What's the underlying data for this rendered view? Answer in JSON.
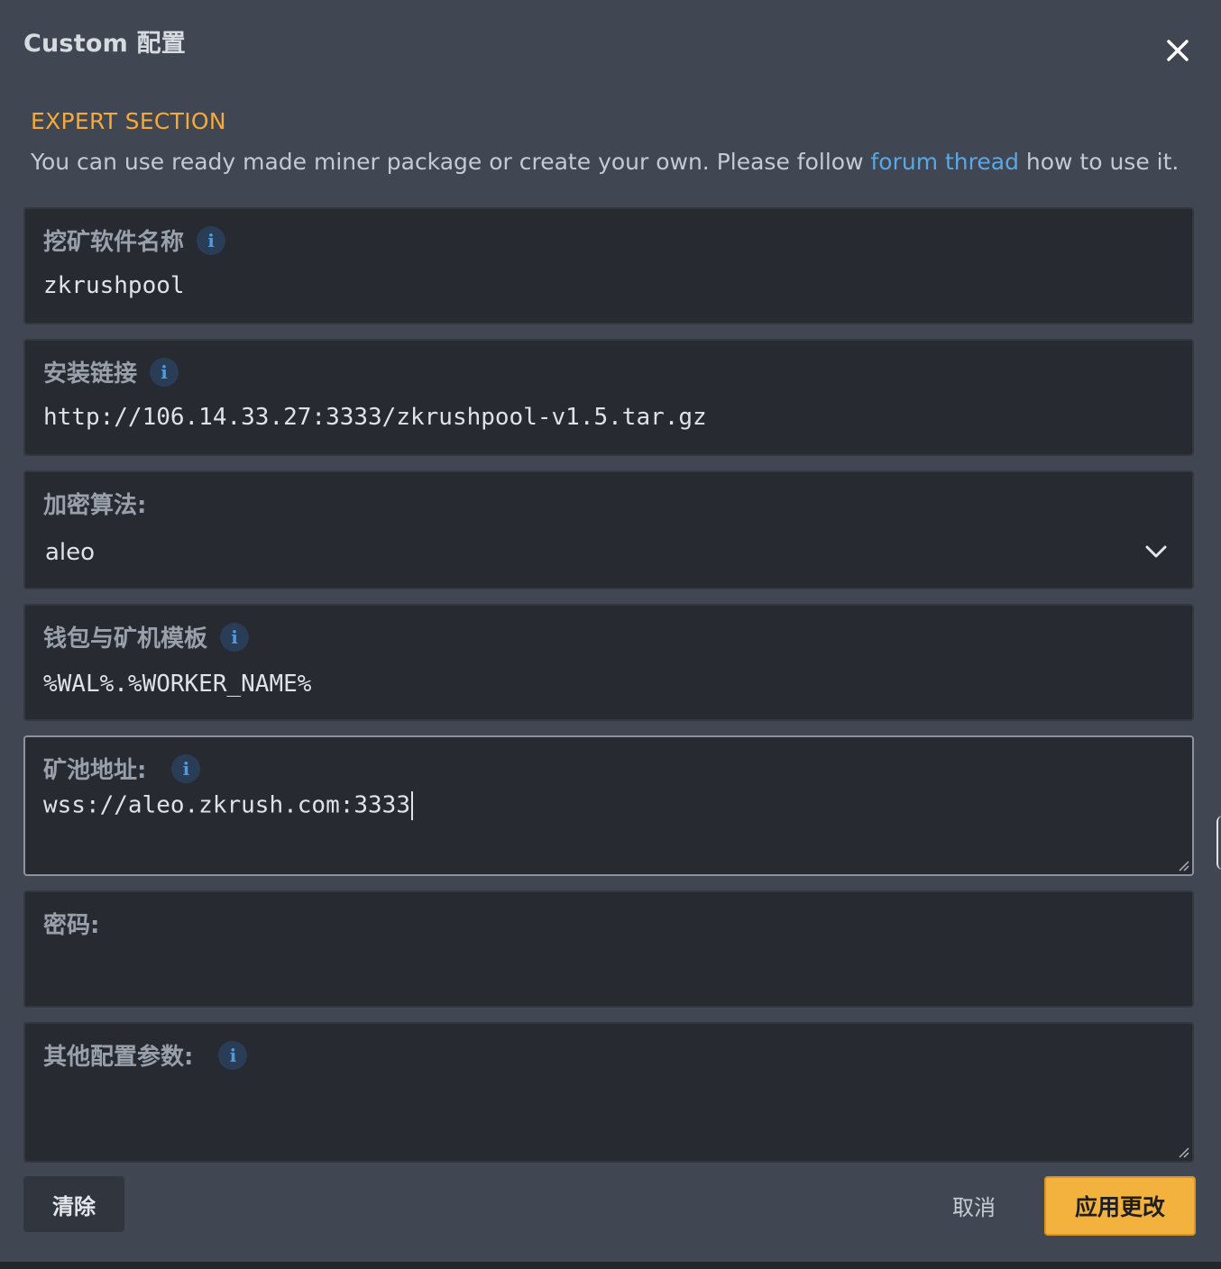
{
  "dialog": {
    "title": "Custom 配置",
    "close_icon": "close-icon"
  },
  "expert": {
    "heading": "EXPERT SECTION",
    "desc_before": "You can use ready made miner package or create your own. Please follow ",
    "link_text": "forum thread",
    "desc_after": " how to use it."
  },
  "fields": {
    "miner_name": {
      "label": "挖矿软件名称",
      "value": "zkrushpool",
      "icon": "info-icon"
    },
    "install_url": {
      "label": "安装链接",
      "value": "http://106.14.33.27:3333/zkrushpool-v1.5.tar.gz",
      "icon": "info-icon"
    },
    "algorithm": {
      "label": "加密算法:",
      "value": "aleo",
      "icon": "chevron-down-icon"
    },
    "wallet_template": {
      "label": "钱包与矿机模板",
      "value": "%WAL%.%WORKER_NAME%",
      "icon": "info-icon"
    },
    "pool_url": {
      "label": "矿池地址:",
      "value": "wss://aleo.zkrush.com:3333",
      "icon": "info-icon"
    },
    "password": {
      "label": "密码:",
      "value": ""
    },
    "extra_args": {
      "label": "其他配置参数:",
      "value": "",
      "icon": "info-icon"
    }
  },
  "footer": {
    "clear_label": "清除",
    "cancel_label": "取消",
    "apply_label": "应用更改"
  },
  "colors": {
    "accent": "#f3b23e",
    "link": "#59a8e6",
    "expert_heading": "#f5a93a",
    "background": "#404753",
    "field_background": "#272a30"
  }
}
